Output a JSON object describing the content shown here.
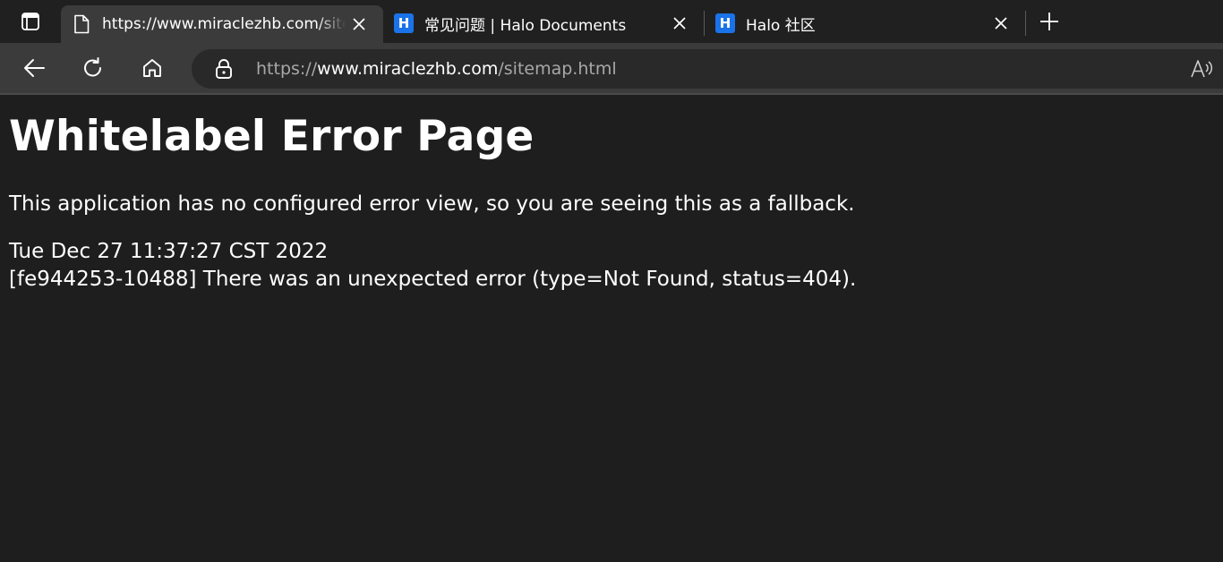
{
  "browser": {
    "tabs": [
      {
        "title": "https://www.miraclezhb.com/sitemap.html",
        "favicon": "page-icon",
        "active": true
      },
      {
        "title": "常见问题 | Halo Documents",
        "favicon": "halo-logo-icon",
        "badge_text": "H",
        "active": false
      },
      {
        "title": "Halo 社区",
        "favicon": "halo-logo-icon",
        "badge_text": "H",
        "active": false
      }
    ],
    "address": {
      "scheme": "https://",
      "host": "www.miraclezhb.com",
      "path": "/sitemap.html"
    },
    "colors": {
      "tab_strip": "#202020",
      "toolbar": "#3b3b3b",
      "page_bg": "#1e1e1e",
      "halo_blue": "#1a73e8"
    }
  },
  "page": {
    "title": "Whitelabel Error Page",
    "description": "This application has no configured error view, so you are seeing this as a fallback.",
    "timestamp": "Tue Dec 27 11:37:27 CST 2022",
    "error": "[fe944253-10488] There was an unexpected error (type=Not Found, status=404)."
  }
}
